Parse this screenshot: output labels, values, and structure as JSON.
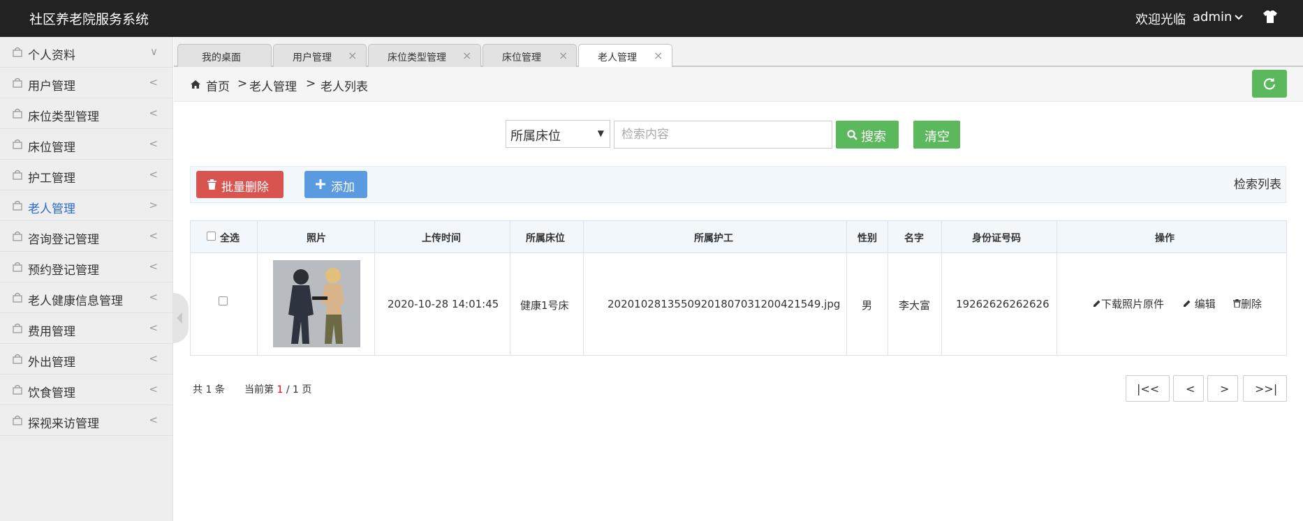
{
  "header": {
    "app_title": "社区养老院服务系统",
    "welcome": "欢迎光临",
    "user": "admin"
  },
  "sidebar": {
    "items": [
      {
        "label": "个人资料",
        "arrow": "∨"
      },
      {
        "label": "用户管理",
        "arrow": "<"
      },
      {
        "label": "床位类型管理",
        "arrow": "<"
      },
      {
        "label": "床位管理",
        "arrow": "<"
      },
      {
        "label": "护工管理",
        "arrow": "<"
      },
      {
        "label": "老人管理",
        "arrow": ">",
        "active": true
      },
      {
        "label": "咨询登记管理",
        "arrow": "<"
      },
      {
        "label": "预约登记管理",
        "arrow": "<"
      },
      {
        "label": "老人健康信息管理",
        "arrow": "<"
      },
      {
        "label": "费用管理",
        "arrow": "<"
      },
      {
        "label": "外出管理",
        "arrow": "<"
      },
      {
        "label": "饮食管理",
        "arrow": "<"
      },
      {
        "label": "探视来访管理",
        "arrow": "<"
      }
    ]
  },
  "tabs": [
    {
      "label": "我的桌面",
      "closable": false
    },
    {
      "label": "用户管理",
      "closable": true
    },
    {
      "label": "床位类型管理",
      "closable": true
    },
    {
      "label": "床位管理",
      "closable": true
    },
    {
      "label": "老人管理",
      "closable": true,
      "active": true
    }
  ],
  "breadcrumb": {
    "home": "首页",
    "sep": ">",
    "level1": "老人管理",
    "level2": "老人列表"
  },
  "search": {
    "select_value": "所属床位",
    "placeholder": "检索内容",
    "search_label": "搜索",
    "clear_label": "清空"
  },
  "toolbar": {
    "batch_delete": "批量删除",
    "add": "添加",
    "search_list": "检索列表"
  },
  "table": {
    "headers": [
      "全选",
      "照片",
      "上传时间",
      "所属床位",
      "所属护工",
      "性别",
      "名字",
      "身份证号码",
      "操作"
    ],
    "rows": [
      {
        "upload_time": "2020-10-28 14:01:45",
        "bed": "健康1号床",
        "caregiver": "20201028135509201807031200421549.jpg",
        "gender": "男",
        "name": "李大富",
        "id_number": "19262626262626",
        "actions": {
          "download": "下载照片原件",
          "edit": "编辑",
          "delete": "删除"
        }
      }
    ]
  },
  "pager": {
    "total_prefix": "共",
    "total": "1",
    "total_suffix": "条",
    "current_prefix": "当前第",
    "current": "1",
    "pages_suffix": "/ 1 页",
    "first": "|<<",
    "prev": "<",
    "next": ">",
    "last": ">>|"
  },
  "colors": {
    "topbar": "#222222",
    "sidebar_bg": "#eeeeee",
    "active_link": "#2a6ac8",
    "green": "#5cb85c",
    "red": "#d9534f",
    "blue": "#5a9ae0"
  }
}
